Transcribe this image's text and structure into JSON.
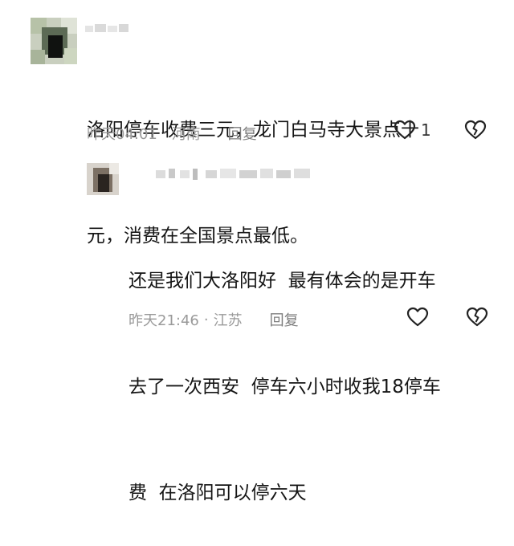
{
  "comments": [
    {
      "text_line1": "洛阳停车收费三元，龙门白马寺大景点十",
      "text_line2": "元，消费在全国景点最低。",
      "time": "昨天04:01",
      "location": "河南",
      "reply_label": "回复",
      "like_count": "1"
    },
    {
      "text_line1": "还是我们大洛阳好  最有体会的是开车",
      "text_line2": "去了一次西安  停车六小时收我18停车",
      "text_line3": "费  在洛阳可以停六天",
      "time": "昨天21:46",
      "location": "江苏",
      "reply_label": "回复",
      "like_count": ""
    }
  ],
  "icons": {
    "like": "heart-outline-icon",
    "dislike": "broken-heart-icon"
  },
  "colors": {
    "meta": "#9a9a9a",
    "text": "#151515"
  }
}
